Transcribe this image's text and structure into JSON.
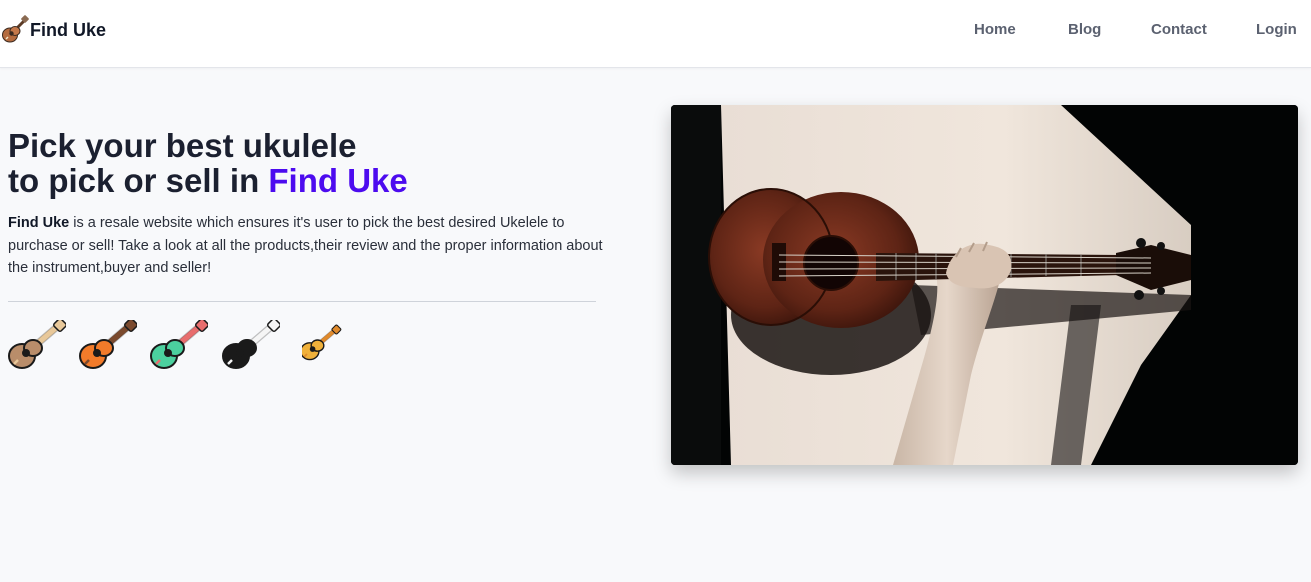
{
  "brand": {
    "name": "Find Uke",
    "logo_icon": "ukulele-logo-icon"
  },
  "nav": {
    "links": [
      {
        "label": "Home"
      },
      {
        "label": "Blog"
      },
      {
        "label": "Contact"
      },
      {
        "label": "Login"
      }
    ]
  },
  "hero": {
    "title_line1": "Pick your best ukulele",
    "title_line2_prefix": "to pick or sell in ",
    "title_accent": "Find Uke",
    "description_brand": "Find Uke",
    "description_rest": " is a resale website which ensures it's user to pick the best desired Ukelele to purchase or sell! Take a look at all the products,their review and the proper information about the instrument,buyer and seller!",
    "accent_color": "#4c0bef"
  },
  "ukulele_icons": [
    {
      "name": "brown-ukulele-icon",
      "body": "#b98d6a",
      "neck": "#e8c89a"
    },
    {
      "name": "orange-ukulele-icon",
      "body": "#f27b2a",
      "neck": "#7b4a2e"
    },
    {
      "name": "green-ukulele-icon",
      "body": "#4bd09e",
      "neck": "#e86e6e"
    },
    {
      "name": "black-ukulele-icon",
      "body": "#1a1a1a",
      "neck": "#f5f5f5"
    },
    {
      "name": "yellow-ukulele-icon",
      "body": "#f0b13a",
      "neck": "#e08a2c"
    }
  ],
  "photo": {
    "name": "hand-holding-ukulele-photo"
  }
}
